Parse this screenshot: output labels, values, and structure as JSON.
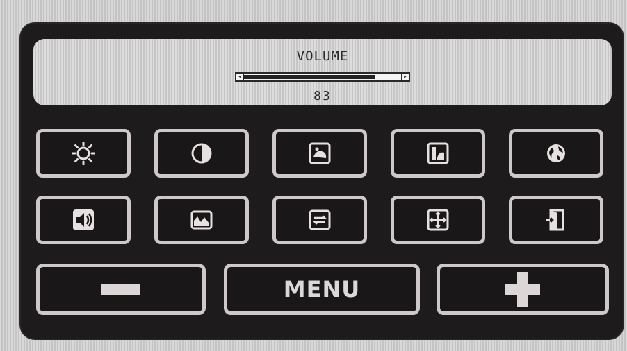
{
  "volume": {
    "title": "VOLUME",
    "value": "83",
    "level_percent": 83,
    "left_arrow": "◂",
    "right_arrow": "▸"
  },
  "icons_row1": [
    {
      "name": "brightness-icon"
    },
    {
      "name": "contrast-icon"
    },
    {
      "name": "picture-position-icon"
    },
    {
      "name": "picture-size-icon"
    },
    {
      "name": "language-globe-icon"
    }
  ],
  "icons_row2": [
    {
      "name": "audio-speaker-icon"
    },
    {
      "name": "color-temperature-icon"
    },
    {
      "name": "input-source-icon"
    },
    {
      "name": "geometry-icon"
    },
    {
      "name": "exit-door-icon"
    }
  ],
  "buttons": {
    "minus": "−",
    "menu": "MENU",
    "plus": "+"
  },
  "colors": {
    "osd_background": "#1e1b1c",
    "panel_background": "#d3d2d2",
    "button_border": "#cfc8c8"
  }
}
